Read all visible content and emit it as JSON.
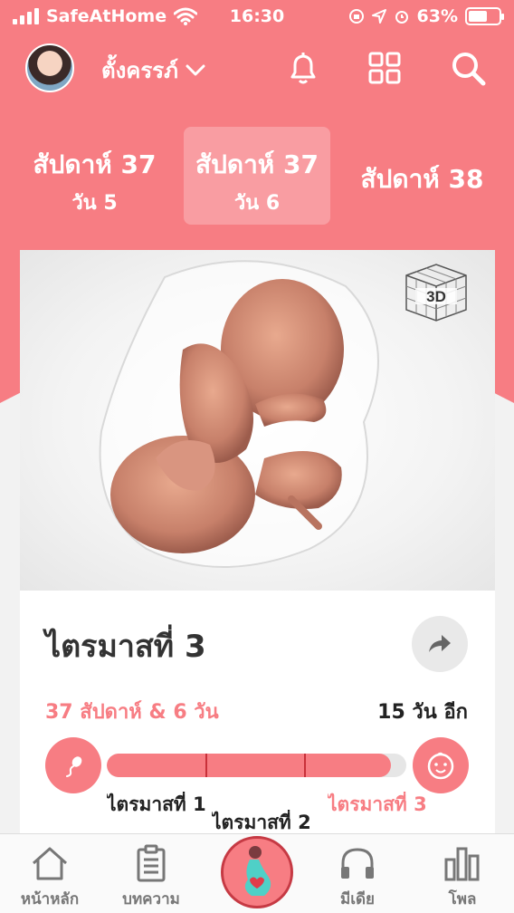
{
  "status_bar": {
    "carrier": "SafeAtHome",
    "time": "16:30",
    "battery_percent": "63%",
    "battery_level": 0.63,
    "icons": [
      "signal-icon",
      "wifi-icon",
      "screen-lock-icon",
      "location-icon",
      "alarm-icon",
      "battery-icon"
    ]
  },
  "header": {
    "user_name": "ตั้งครรภ์",
    "icons": [
      "chevron-down-icon",
      "bell-icon",
      "grid-icon",
      "search-icon"
    ]
  },
  "weeks": [
    {
      "week": "สัปดาห์ 37",
      "day": "วัน 5"
    },
    {
      "week": "สัปดาห์ 37",
      "day": "วัน 6",
      "active": true
    },
    {
      "week": "สัปดาห์ 38",
      "day": ""
    }
  ],
  "card": {
    "badge_3d": "3D",
    "trimester_title": "ไตรมาสที่ 3",
    "progress_text": "37 สัปดาห์ & 6 วัน",
    "remaining_text": "15 วัน อีก",
    "progress_fraction": 0.95,
    "trimester_markers": [
      0.33,
      0.66
    ],
    "trimester_labels": [
      "ไตรมาสที่ 1",
      "ไตรมาสที่ 2",
      "ไตรมาสที่ 3"
    ]
  },
  "tabbar": {
    "items": [
      {
        "label": "หน้าหลัก",
        "icon": "home-icon"
      },
      {
        "label": "บทความ",
        "icon": "clipboard-icon"
      },
      {
        "label": "",
        "icon": "pregnancy-icon"
      },
      {
        "label": "มีเดีย",
        "icon": "headphones-icon"
      },
      {
        "label": "โพล",
        "icon": "bar-chart-icon"
      }
    ]
  },
  "colors": {
    "accent": "#f77d83",
    "accent_dark": "#c8313a",
    "background": "#f2f2f2"
  }
}
